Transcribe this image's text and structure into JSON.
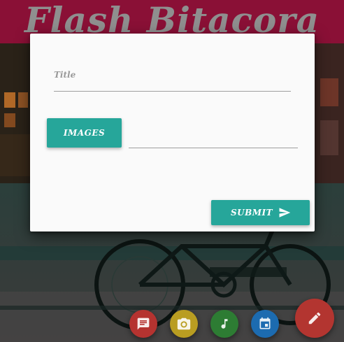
{
  "header": {
    "title": "Flash Bitacora"
  },
  "form": {
    "title_label": "Title",
    "images_button": "IMAGES",
    "submit_button": "SUBMIT"
  },
  "fabs": [
    {
      "icon": "chat-icon",
      "color": "#b53330"
    },
    {
      "icon": "camera-icon",
      "color": "#b99d21"
    },
    {
      "icon": "music-note-icon",
      "color": "#2d7c33"
    },
    {
      "icon": "calendar-icon",
      "color": "#1c6bb0"
    },
    {
      "icon": "edit-pencil-icon",
      "color": "#b33530"
    }
  ],
  "colors": {
    "header_bg": "#8a1036",
    "accent": "#26a69a",
    "dialog_bg": "#fafafa"
  }
}
